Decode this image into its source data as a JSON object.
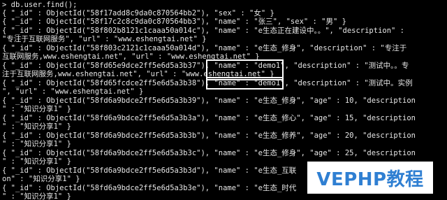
{
  "terminal": {
    "lines": [
      "> db.user.find();",
      "{ \"_id\" : ObjectId(\"58f17add8c9da0c870564bb2\"), \"sex\" : \"女\" }",
      "{ \"_id\" : ObjectId(\"58f17c2c8c9da0c870564bb3\"), \"name\" : \"张三\", \"sex\" : \"男\" }",
      "{ \"_id\" : ObjectId(\"58f802b8121c1caaa50a014c\"), \"name\" : \"e生态正在建设中。。\", \"description\" :",
      "\"专注于互联网服务\", \"url\" : \"www.eshengtai.net\" }",
      "{ \"_id\" : ObjectId(\"58f803c2121c1caaa50a014d\"), \"name\" : \"e生态_修身\", \"description\" : \"专注于",
      "互联网服务,www.eshengtai.net\", \"url\" : \"www.eshengtai.net\" }",
      "{ \"_id\" : ObjectId(\"58fd65e9dce2ff5e6d5a3b37\"), \"name\" : \"demo1\", \"description\" : \"测试中。。专",
      "注于互联网服务,www.eshengtai.net\", \"url\" : \"www.eshengtai.net\" }",
      "{ \"_id\" : ObjectId(\"58fd65fcdce2ff5e6d5a3b38\"), \"name\" : \"demo1\", \"description\" : \"测试中。实例",
      "\", \"url\" : \"www.eshengtai.net\" }",
      "{ \"_id\" : ObjectId(\"58fd6a9bdce2ff5e6d5a3b39\"), \"name\" : \"e生态_修身\", \"age\" : 10, \"description",
      "\" : \"知识分享1\" }",
      "{ \"_id\" : ObjectId(\"58fd6a9bdce2ff5e6d5a3b3a\"), \"name\" : \"e生态_修心\", \"age\" : 15, \"description",
      "\" : \"知识分享1\" }",
      "{ \"_id\" : ObjectId(\"58fd6a9bdce2ff5e6d5a3b3b\"), \"name\" : \"e生态_修养\", \"age\" : 20, \"description",
      "\" : \"知识分享1\" }",
      "{ \"_id\" : ObjectId(\"58fd6a9bdce2ff5e6d5a3b3c\"), \"name\" : \"e生态_修身\", \"age\" : 25, \"description",
      "\" : \"知识分享1\" }",
      "{ \"_id\" : ObjectId(\"58fd6a9bdce2ff5e6d5a3b3d\"), \"name\" : \"e生态_互联",
      "on\" : \"知识分享1\" }",
      "{ \"_id\" : ObjectId(\"58fd6a9bdce2ff5e6d5a3b3e\"), \"name\" : \"e生态_时代",
      "\" : \"知识分享1\" }"
    ]
  },
  "watermark": {
    "text": "VEPHP教程",
    "color": "#2f7fd2"
  }
}
